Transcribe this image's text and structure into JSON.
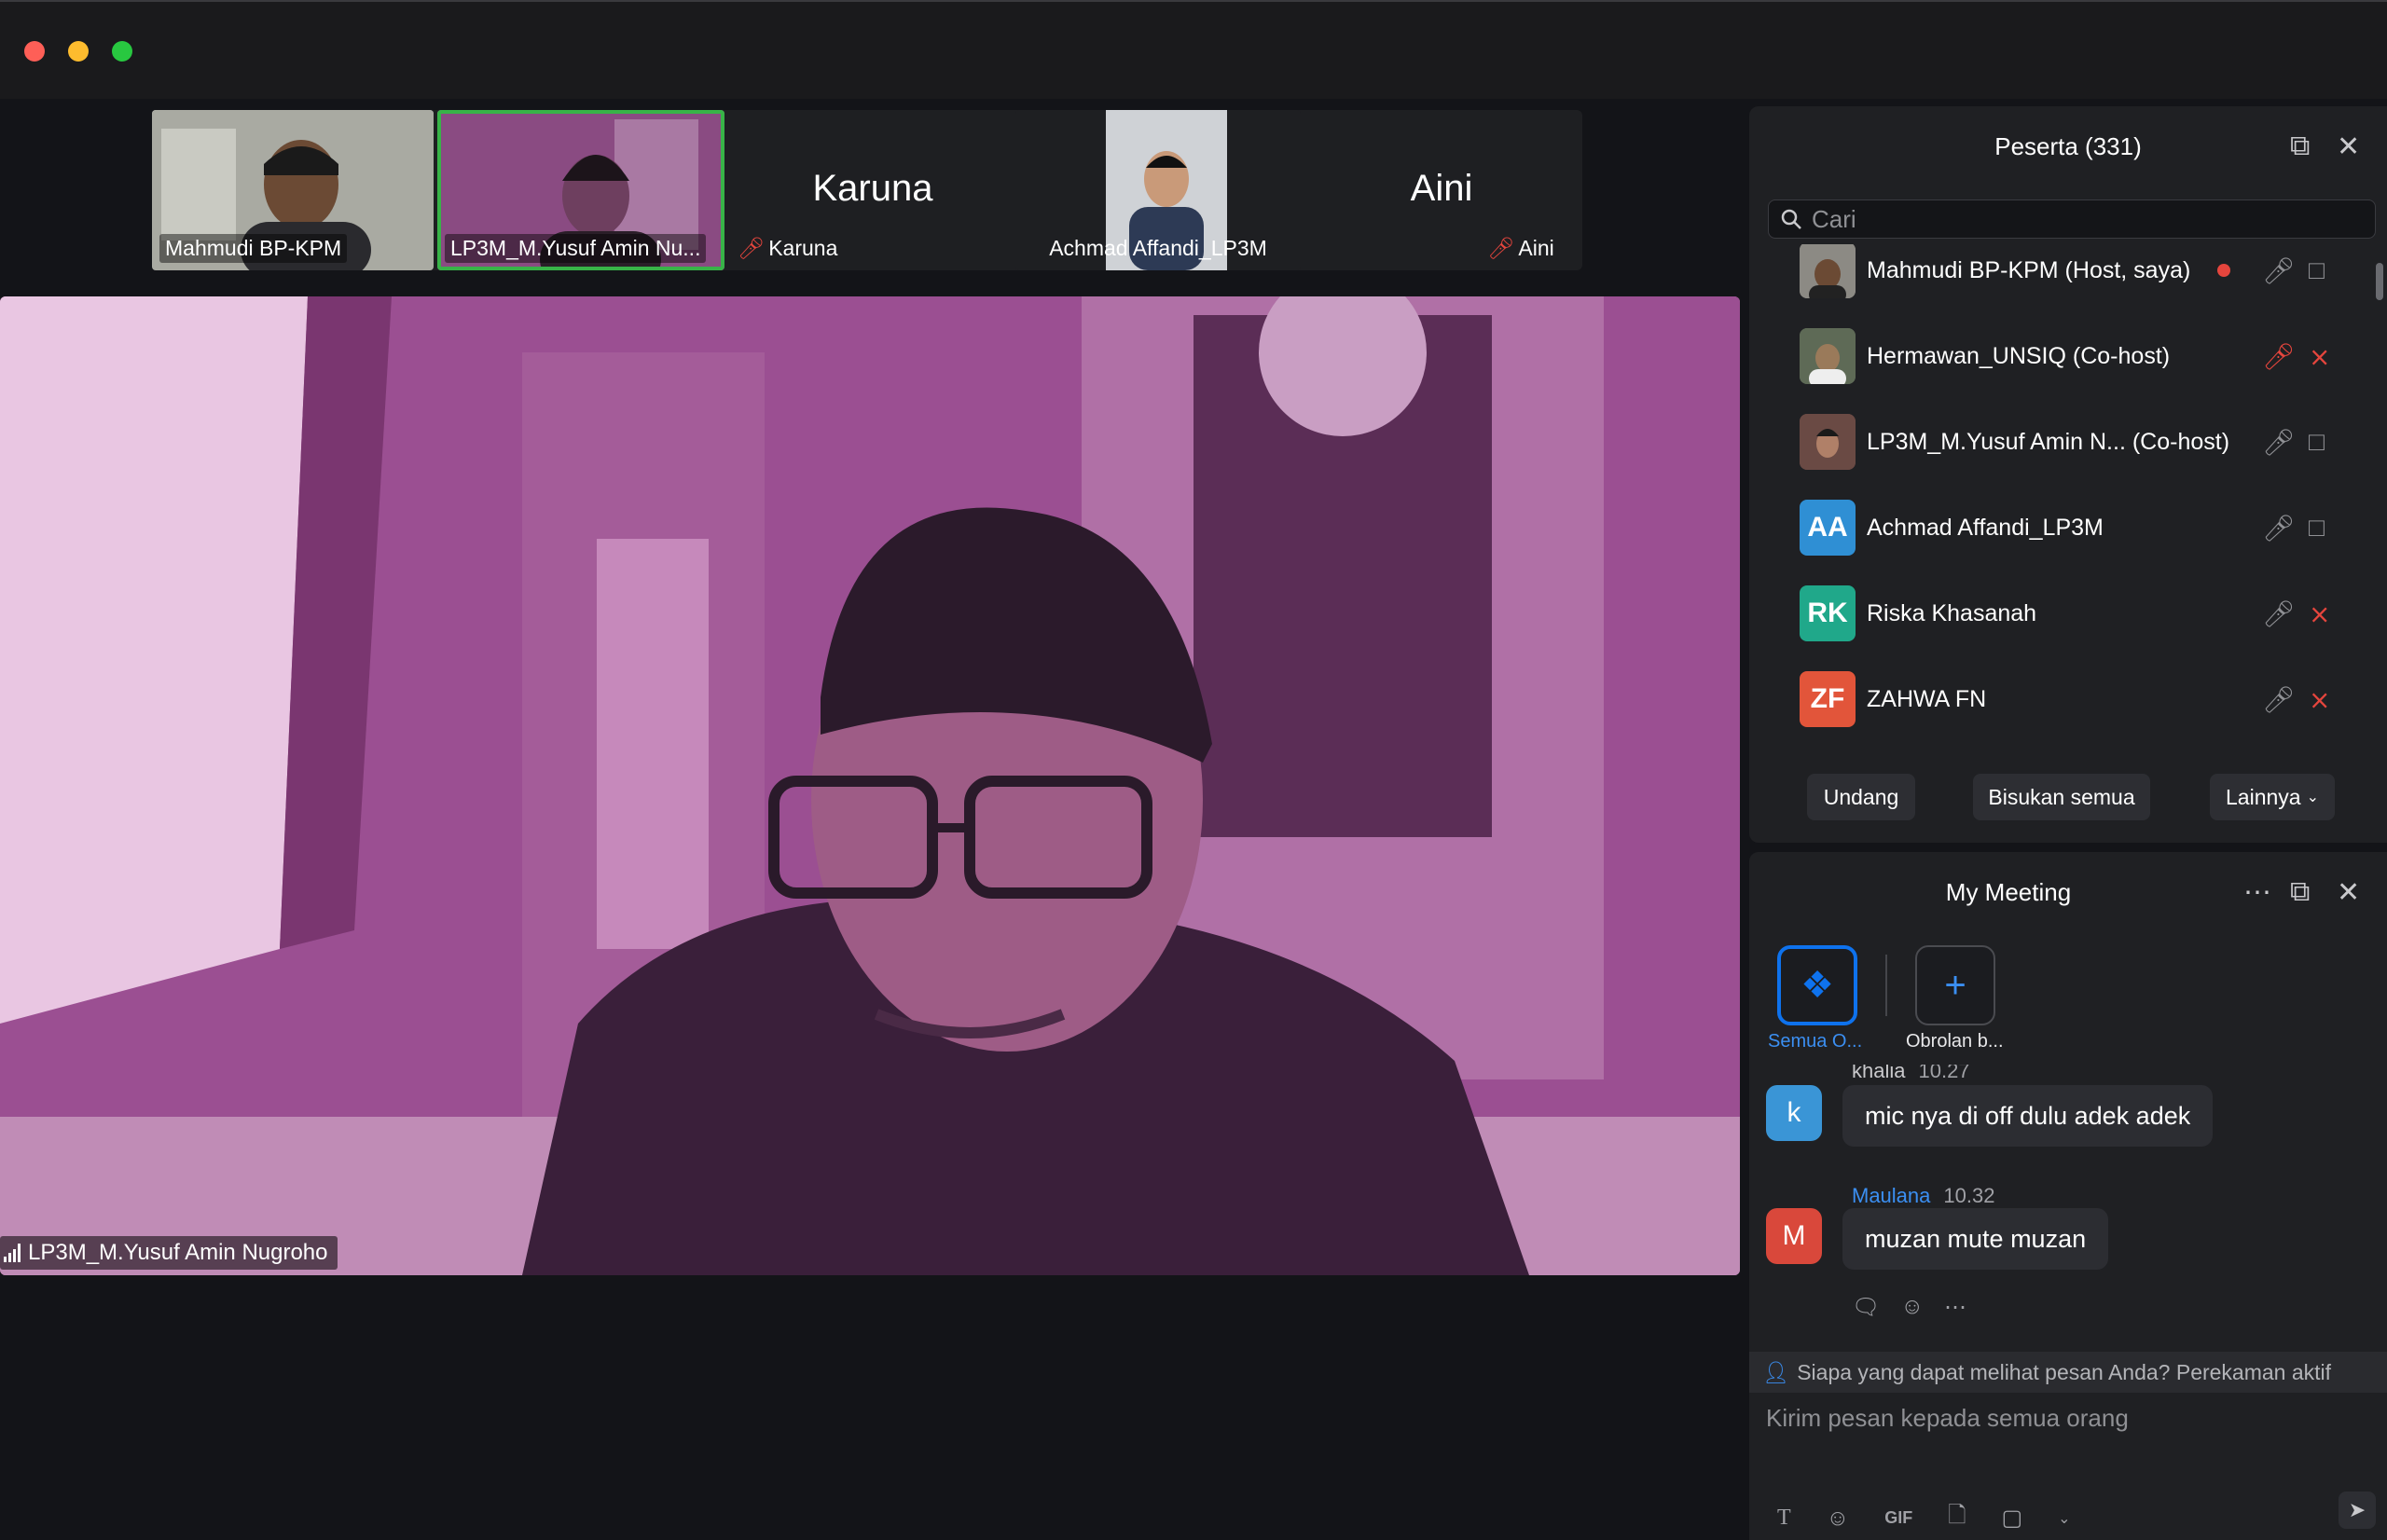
{
  "colors": {
    "accent": "#0e72ed",
    "active_border": "#38b348",
    "muted_red": "#e5453d"
  },
  "thumbnails": [
    {
      "name": "Mahmudi BP-KPM",
      "type": "video"
    },
    {
      "name": "LP3M_M.Yusuf Amin Nu...",
      "type": "video"
    },
    {
      "big": "Karuna",
      "name": "Karuna",
      "muted": true
    },
    {
      "name": "Achmad Affandi_LP3M",
      "type": "video"
    },
    {
      "big": "Aini",
      "name": "Aini",
      "muted": true
    }
  ],
  "main": {
    "speaker_label": "LP3M_M.Yusuf Amin Nugroho"
  },
  "participants": {
    "title": "Peserta (331)",
    "search_placeholder": "Cari",
    "list": [
      {
        "name": "Mahmudi BP-KPM (Host, saya)",
        "avatar": "photo",
        "mic": "on",
        "cam": "on"
      },
      {
        "name": "Hermawan_UNSIQ (Co-host)",
        "avatar": "photo",
        "mic": "muted",
        "cam": "off"
      },
      {
        "name": "LP3M_M.Yusuf Amin N...  (Co-host)",
        "avatar": "photo",
        "mic": "on",
        "cam": "on"
      },
      {
        "name": "Achmad Affandi_LP3M",
        "initials": "AA",
        "color": "#2f8fd4",
        "mic": "on",
        "cam": "on"
      },
      {
        "name": "Riska Khasanah",
        "initials": "RK",
        "color": "#20a88a",
        "mic": "on",
        "cam": "off"
      },
      {
        "name": "ZAHWA FN",
        "initials": "ZF",
        "color": "#e2553a",
        "mic": "on",
        "cam": "off"
      }
    ],
    "buttons": {
      "invite": "Undang",
      "mute_all": "Bisukan semua",
      "more": "Lainnya"
    }
  },
  "chat": {
    "title": "My Meeting",
    "channels": [
      {
        "label": "Semua O...",
        "icon": "people-icon",
        "active": true
      },
      {
        "label": "Obrolan b...",
        "icon": "plus-icon",
        "active": false
      }
    ],
    "messages": [
      {
        "sender": "khalia",
        "time": "10.27",
        "initial": "k",
        "color": "#3a95d6",
        "text": "mic nya di off dulu adek adek"
      },
      {
        "sender": "Maulana",
        "time": "10.32",
        "initial": "M",
        "color": "#d9483b",
        "text": "muzan mute muzan"
      }
    ],
    "notice": "Siapa yang dapat melihat pesan Anda? Perekaman aktif",
    "compose_placeholder": "Kirim pesan kepada semua orang",
    "toolbar": {
      "gif": "GIF"
    }
  }
}
